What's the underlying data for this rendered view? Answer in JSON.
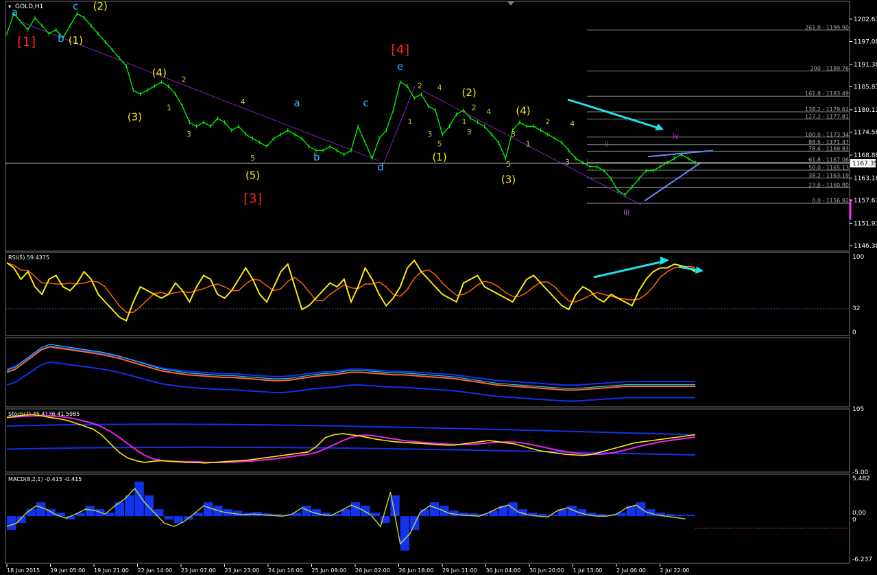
{
  "chart_data": {
    "type": "line",
    "symbol_label": "GOLD,H1",
    "main_panel": {
      "price_ticks": [
        "1202.63",
        "1197.08",
        "1191.38",
        "1185.83",
        "1180.13",
        "1174.58",
        "1168.88",
        "1163.18",
        "1157.63",
        "1151.93",
        "1146.38"
      ],
      "current_price": "1167.35",
      "price_min": 1146.38,
      "price_max": 1205.0,
      "close_series": [
        1199,
        1204,
        1202,
        1200,
        1203,
        1201,
        1199,
        1200,
        1198,
        1201,
        1204,
        1203,
        1201,
        1199,
        1197,
        1195,
        1193,
        1191,
        1185,
        1184,
        1185,
        1186,
        1187,
        1186,
        1184,
        1181,
        1177,
        1176,
        1177,
        1176,
        1178,
        1177,
        1175,
        1176,
        1174,
        1173,
        1172,
        1171,
        1173,
        1174,
        1175,
        1174,
        1173,
        1171,
        1170,
        1170,
        1171,
        1170,
        1169,
        1170,
        1176,
        1172,
        1168,
        1173,
        1175,
        1180,
        1187,
        1186,
        1183,
        1184,
        1181,
        1180,
        1174,
        1176,
        1179,
        1180,
        1178,
        1177,
        1176,
        1174,
        1172,
        1168,
        1175,
        1177,
        1176,
        1176,
        1175,
        1174,
        1173,
        1172,
        1170,
        1168,
        1167,
        1166,
        1166,
        1165,
        1163,
        1160,
        1159,
        1161,
        1163,
        1165,
        1165,
        1166,
        1167,
        1168,
        1169,
        1168,
        1167
      ],
      "fib_levels": [
        {
          "label": "261.8 - 1199.90",
          "price": 1199.9
        },
        {
          "label": "200 - 1189.76",
          "price": 1189.76
        },
        {
          "label": "161.8 - 1183.49",
          "price": 1183.49
        },
        {
          "label": "138.2 - 1179.61",
          "price": 1179.61
        },
        {
          "label": "127.2 - 1177.81",
          "price": 1177.81
        },
        {
          "label": "100.0 - 1173.34",
          "price": 1173.34
        },
        {
          "label": "88.6 - 1171.47",
          "price": 1171.47
        },
        {
          "label": "78.6 - 1169.83",
          "price": 1169.83
        },
        {
          "label": "61.8 - 1167.06",
          "price": 1167.06
        },
        {
          "label": "50.0 - 1165.13",
          "price": 1165.13
        },
        {
          "label": "38.2 - 1163.19",
          "price": 1163.19
        },
        {
          "label": "23.6 - 1160.80",
          "price": 1160.8
        },
        {
          "label": "0.0 - 1156.92",
          "price": 1156.92
        }
      ],
      "wave_labels": [
        {
          "text": "a",
          "color": "#33bbff",
          "x": 0.8,
          "price": 1203.5
        },
        {
          "text": "c",
          "color": "#33bbff",
          "x": 7.0,
          "price": 1205
        },
        {
          "text": "(2)",
          "color": "#ffee00",
          "x": 9.5,
          "price": 1205
        },
        {
          "text": "[1]",
          "color": "#ff2222",
          "x": 2.0,
          "price": 1196
        },
        {
          "text": "b",
          "color": "#33bbff",
          "x": 5.5,
          "price": 1197
        },
        {
          "text": "(1)",
          "color": "#ffee00",
          "x": 7.0,
          "price": 1196.5
        },
        {
          "text": "(4)",
          "color": "#ffee00",
          "x": 15.5,
          "price": 1188.5
        },
        {
          "text": "2",
          "color": "#bbcc44",
          "x": 18.0,
          "price": 1187
        },
        {
          "text": "(3)",
          "color": "#ffee00",
          "x": 13.0,
          "price": 1177.5
        },
        {
          "text": "1",
          "color": "#bbcc44",
          "x": 16.5,
          "price": 1180
        },
        {
          "text": "3",
          "color": "#bbcc44",
          "x": 18.5,
          "price": 1173.5
        },
        {
          "text": "4",
          "color": "#bbcc44",
          "x": 24.0,
          "price": 1181.5
        },
        {
          "text": "5",
          "color": "#bbcc44",
          "x": 25.0,
          "price": 1167.5
        },
        {
          "text": "(5)",
          "color": "#ffee00",
          "x": 25.0,
          "price": 1163
        },
        {
          "text": "[3]",
          "color": "#ff2222",
          "x": 25.0,
          "price": 1157
        },
        {
          "text": "a",
          "color": "#33bbff",
          "x": 29.5,
          "price": 1181
        },
        {
          "text": "b",
          "color": "#33bbff",
          "x": 31.5,
          "price": 1167.5
        },
        {
          "text": "c",
          "color": "#33bbff",
          "x": 36.5,
          "price": 1181
        },
        {
          "text": "d",
          "color": "#33bbff",
          "x": 38.0,
          "price": 1165
        },
        {
          "text": "[4]",
          "color": "#ff2222",
          "x": 40.0,
          "price": 1194
        },
        {
          "text": "e",
          "color": "#33bbff",
          "x": 40.0,
          "price": 1190
        },
        {
          "text": "2",
          "color": "#bbcc44",
          "x": 42.0,
          "price": 1185.5
        },
        {
          "text": "4",
          "color": "#bbcc44",
          "x": 44.0,
          "price": 1185
        },
        {
          "text": "1",
          "color": "#bbcc44",
          "x": 41.0,
          "price": 1176.5
        },
        {
          "text": "3",
          "color": "#bbcc44",
          "x": 43.0,
          "price": 1173.5
        },
        {
          "text": "5",
          "color": "#bbcc44",
          "x": 44.0,
          "price": 1171
        },
        {
          "text": "(1)",
          "color": "#ffee00",
          "x": 44.0,
          "price": 1167.5
        },
        {
          "text": "(2)",
          "color": "#ffee00",
          "x": 47.0,
          "price": 1183.5
        },
        {
          "text": "2",
          "color": "#bbcc44",
          "x": 47.5,
          "price": 1180
        },
        {
          "text": "1",
          "color": "#bbcc44",
          "x": 46.5,
          "price": 1176.5
        },
        {
          "text": "3",
          "color": "#bbcc44",
          "x": 47.0,
          "price": 1174
        },
        {
          "text": "4",
          "color": "#bbcc44",
          "x": 49.0,
          "price": 1179
        },
        {
          "text": "(4)",
          "color": "#ffee00",
          "x": 52.5,
          "price": 1179
        },
        {
          "text": "2",
          "color": "#bbcc44",
          "x": 55.0,
          "price": 1176.5
        },
        {
          "text": "1",
          "color": "#bbcc44",
          "x": 53.0,
          "price": 1171
        },
        {
          "text": "3",
          "color": "#bbcc44",
          "x": 51.5,
          "price": 1173.5
        },
        {
          "text": "5",
          "color": "#bbcc44",
          "x": 51.0,
          "price": 1166
        },
        {
          "text": "(3)",
          "color": "#ffee00",
          "x": 51.0,
          "price": 1162
        },
        {
          "text": "4",
          "color": "#bbcc44",
          "x": 57.5,
          "price": 1176
        },
        {
          "text": "3",
          "color": "#bbcc44",
          "x": 57.0,
          "price": 1166.5
        },
        {
          "text": "i",
          "color": "#cc44cc",
          "x": 59.0,
          "price": 1166.5
        },
        {
          "text": "ii",
          "color": "#cc44cc",
          "x": 61.0,
          "price": 1171
        },
        {
          "text": "iii",
          "color": "#cc44cc",
          "x": 63.0,
          "price": 1154
        },
        {
          "text": "iv",
          "color": "#cc44cc",
          "x": 68.0,
          "price": 1173
        }
      ]
    },
    "rsi_panel": {
      "label": "RSI(5) 59.4375",
      "levels": [
        "100",
        "32",
        "0"
      ],
      "values": [
        92,
        85,
        70,
        80,
        60,
        50,
        70,
        75,
        60,
        55,
        65,
        80,
        70,
        50,
        40,
        30,
        20,
        15,
        40,
        60,
        55,
        50,
        45,
        50,
        65,
        55,
        40,
        60,
        75,
        70,
        50,
        45,
        55,
        70,
        85,
        70,
        50,
        40,
        60,
        80,
        90,
        60,
        30,
        35,
        45,
        55,
        65,
        60,
        70,
        40,
        60,
        85,
        70,
        50,
        35,
        45,
        60,
        85,
        95,
        80,
        70,
        60,
        50,
        45,
        40,
        65,
        70,
        75,
        60,
        55,
        50,
        45,
        40,
        55,
        70,
        75,
        65,
        55,
        45,
        35,
        30,
        50,
        60,
        55,
        45,
        40,
        50,
        45,
        40,
        35,
        55,
        70,
        80,
        85,
        85,
        90,
        88,
        85,
        80
      ]
    },
    "bands_panel": {
      "values": [
        0.5,
        0.55,
        0.65,
        0.75,
        0.85,
        0.9,
        0.88,
        0.86,
        0.84,
        0.82,
        0.8,
        0.78,
        0.75,
        0.72,
        0.68,
        0.64,
        0.6,
        0.56,
        0.52,
        0.5,
        0.48,
        0.46,
        0.45,
        0.44,
        0.43,
        0.42,
        0.42,
        0.41,
        0.4,
        0.39,
        0.38,
        0.37,
        0.37,
        0.38,
        0.4,
        0.42,
        0.44,
        0.45,
        0.46,
        0.48,
        0.5,
        0.5,
        0.49,
        0.48,
        0.47,
        0.46,
        0.46,
        0.45,
        0.44,
        0.43,
        0.42,
        0.41,
        0.4,
        0.38,
        0.36,
        0.34,
        0.32,
        0.3,
        0.29,
        0.28,
        0.27,
        0.26,
        0.25,
        0.24,
        0.23,
        0.22,
        0.22,
        0.23,
        0.24,
        0.25,
        0.26,
        0.27,
        0.28,
        0.28,
        0.28,
        0.28,
        0.28,
        0.28,
        0.28,
        0.28,
        0.28
      ]
    },
    "stoch_panel": {
      "label": "Stoch(?) 45.4136 41.5985",
      "levels": [
        "105",
        "-5.00"
      ],
      "values": [
        90,
        92,
        94,
        95,
        93,
        90,
        88,
        85,
        80,
        75,
        70,
        60,
        45,
        30,
        20,
        15,
        12,
        14,
        15,
        14,
        13,
        12,
        12,
        11,
        12,
        13,
        14,
        15,
        16,
        18,
        20,
        22,
        24,
        26,
        28,
        30,
        40,
        55,
        60,
        62,
        60,
        58,
        55,
        52,
        50,
        48,
        47,
        46,
        45,
        44,
        43,
        42,
        42,
        44,
        46,
        48,
        50,
        48,
        46,
        44,
        40,
        36,
        32,
        30,
        28,
        26,
        25,
        24,
        26,
        30,
        34,
        38,
        42,
        46,
        48,
        50,
        52,
        54,
        56,
        58,
        60
      ]
    },
    "macd_panel": {
      "label": "MACD(8,2,1) -0.415 -0.415",
      "levels": [
        "5.482",
        "0.00",
        "0",
        "-6.237"
      ],
      "hist": [
        -2,
        -1,
        1,
        2,
        1,
        0.5,
        -0.5,
        0.5,
        1.5,
        1,
        0.5,
        2,
        3,
        5,
        3,
        1,
        -0.5,
        -1,
        -0.5,
        0.5,
        2,
        1.5,
        1,
        0.8,
        0.5,
        0.6,
        0.4,
        0.3,
        0.2,
        0.5,
        1.5,
        1,
        0.5,
        0.3,
        1,
        2,
        1.5,
        0.5,
        -1,
        3,
        -5,
        -2,
        1,
        2,
        1.5,
        0.8,
        0.5,
        0.4,
        0.3,
        0.8,
        1.5,
        2,
        1,
        0.5,
        0.3,
        0.2,
        1,
        1.5,
        1,
        0.5,
        0.3,
        0.2,
        0.5,
        1.5,
        2,
        1,
        0.5,
        0.3,
        0.2,
        0.2
      ],
      "signal": [
        -1.5,
        -1,
        0.5,
        1.5,
        1,
        0.2,
        -0.3,
        0.3,
        1,
        0.8,
        0.3,
        1.5,
        2.5,
        4,
        2,
        0.5,
        -1,
        -1.5,
        -0.8,
        0.3,
        1.5,
        1,
        0.6,
        0.4,
        0.2,
        0.3,
        0.2,
        0.1,
        0,
        0.3,
        1.2,
        0.6,
        0.2,
        0.1,
        0.8,
        1.6,
        1,
        0.2,
        -1.5,
        3.5,
        -4,
        -2.5,
        0.5,
        1.5,
        1,
        0.4,
        0.2,
        0.1,
        0,
        0.5,
        1.2,
        1.6,
        0.6,
        0.2,
        0,
        -0.1,
        0.8,
        1.2,
        0.6,
        0.2,
        0,
        0,
        0.3,
        1.2,
        1.6,
        0.6,
        0.2,
        0,
        -0.2,
        -0.4
      ]
    },
    "time_ticks": [
      "18 Jun 2015",
      "19 Jun 05:00",
      "19 Jun 21:00",
      "22 Jun 14:00",
      "23 Jun 07:00",
      "23 Jun 23:00",
      "24 Jun 16:00",
      "25 Jun 09:00",
      "26 Jun 02:00",
      "26 Jun 18:00",
      "29 Jun 11:00",
      "30 Jun 04:00",
      "30 Jun 20:00",
      "1 Jul 13:00",
      "2 Jul 06:00",
      "2 Jul 22:00"
    ],
    "colors": {
      "price": "#00ff00",
      "trend_line": "#8822cc",
      "fib": "#888888",
      "annotation_arrow": "#22e0e8",
      "rsi": "#ffee00",
      "rsi_avg": "#ff6600",
      "bands": "#1133ee",
      "macd_hist_up": "#1133ee",
      "macd_signal": "#bbcc44"
    }
  }
}
